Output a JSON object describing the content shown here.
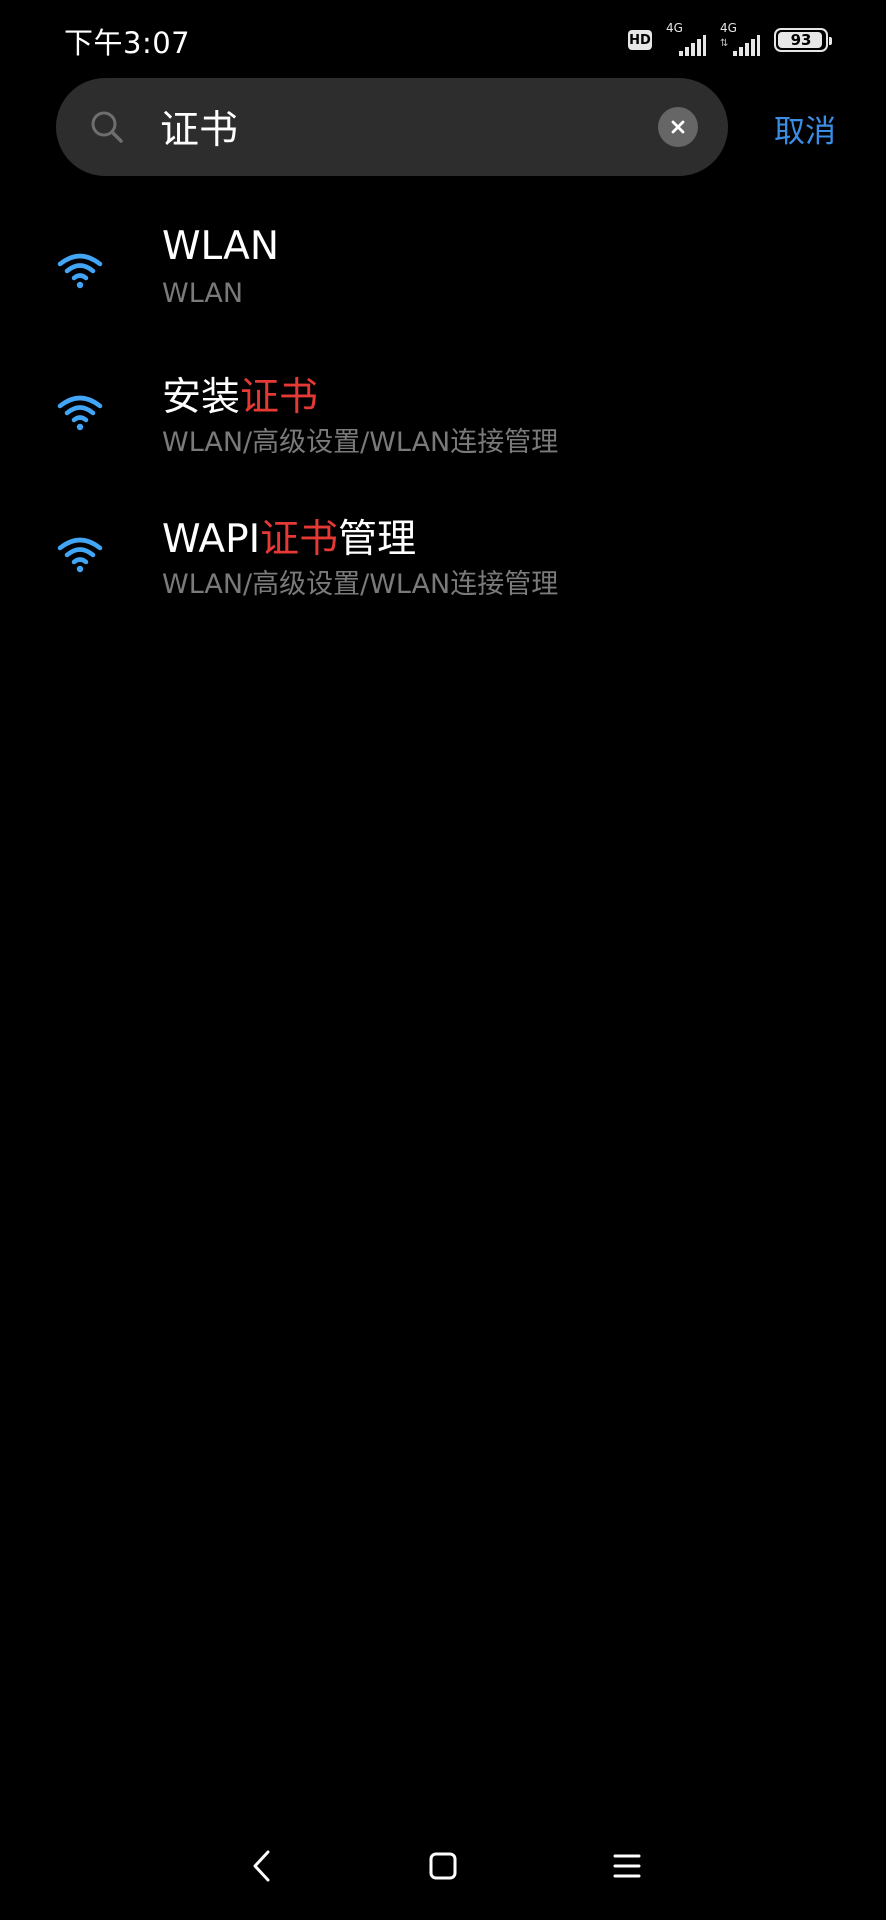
{
  "status_bar": {
    "time": "下午3:07",
    "hd_label": "HD",
    "sim1_network": "4G",
    "sim2_network": "4G",
    "battery_level": "93"
  },
  "search": {
    "query": "证书",
    "placeholder": "",
    "cancel_label": "取消"
  },
  "results": [
    {
      "title_parts": [
        "WLAN",
        "",
        ""
      ],
      "path": "WLAN",
      "icon": "wifi-icon"
    },
    {
      "title_parts": [
        "安装",
        "证书",
        ""
      ],
      "path": "WLAN/高级设置/WLAN连接管理",
      "icon": "wifi-icon"
    },
    {
      "title_parts": [
        "WAPI",
        "证书",
        "管理"
      ],
      "path": "WLAN/高级设置/WLAN连接管理",
      "icon": "wifi-icon"
    }
  ],
  "colors": {
    "accent": "#3a8ee6",
    "highlight": "#e53935",
    "icon_blue": "#42a5f5",
    "search_bg": "#2d2d2d",
    "secondary_text": "#7a7a7a"
  },
  "nav_bar": {
    "back_icon": "back-icon",
    "home_icon": "home-icon",
    "menu_icon": "menu-icon"
  }
}
